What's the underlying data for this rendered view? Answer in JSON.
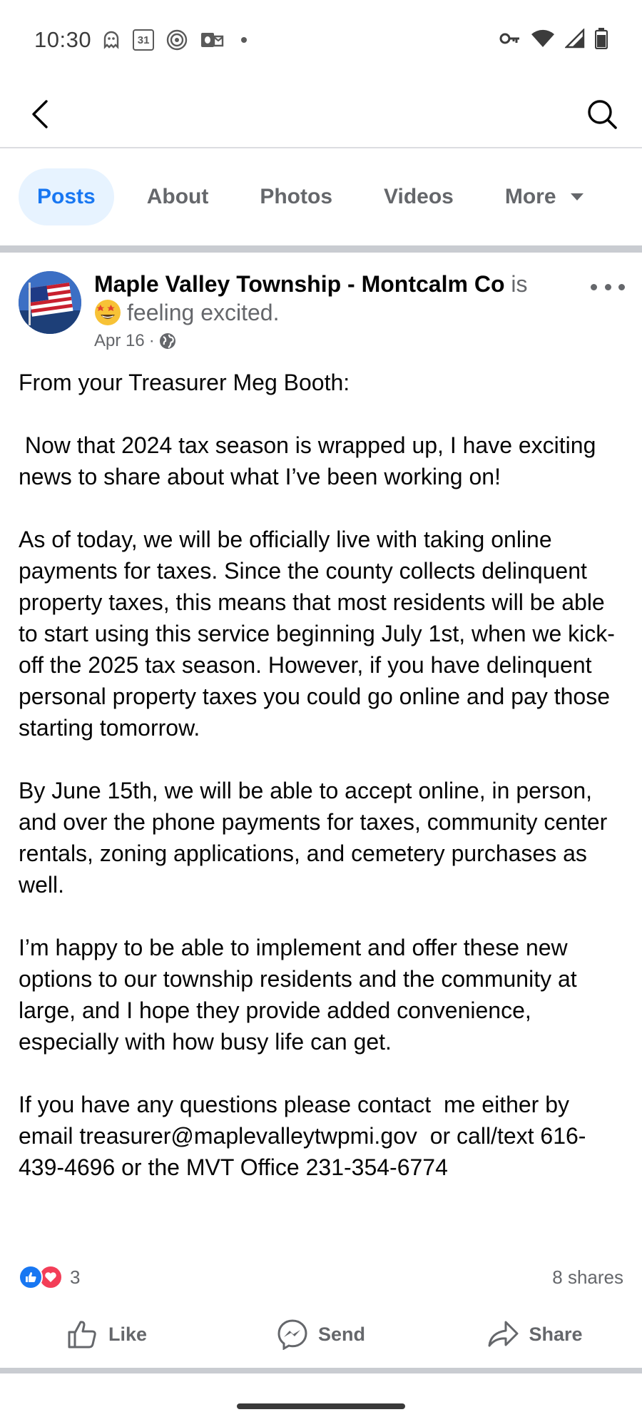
{
  "status_bar": {
    "time": "10:30",
    "left_icons": [
      "ghost-icon",
      "calendar-icon",
      "target-icon",
      "outlook-icon",
      "dot-icon"
    ],
    "calendar_day": "31",
    "right_icons": [
      "vpn-key-icon",
      "wifi-icon",
      "signal-icon",
      "battery-icon"
    ]
  },
  "header": {
    "back_icon": "back-arrow-icon",
    "search_icon": "search-icon"
  },
  "tabs": [
    {
      "label": "Posts",
      "active": true
    },
    {
      "label": "About",
      "active": false
    },
    {
      "label": "Photos",
      "active": false
    },
    {
      "label": "Videos",
      "active": false
    },
    {
      "label": "More",
      "active": false
    }
  ],
  "post": {
    "page_name": "Maple Valley Township - Montcalm Co",
    "is_text": " is",
    "feeling": "feeling excited.",
    "date": "Apr 16",
    "separator": "·",
    "audience_icon": "globe-icon",
    "paragraphs": [
      "From your Treasurer Meg Booth:",
      " Now that 2024 tax season is wrapped up, I have exciting news to share about what I’ve been working on!",
      "As of today, we will be officially live with taking online payments for taxes. Since the county collects delinquent property taxes, this means that most residents will be able to start using this service beginning July 1st, when we kick-off the 2025 tax season. However, if you have delinquent personal property taxes you could go online and pay those starting tomorrow.",
      "By June 15th, we will be able to accept online, in person, and over the phone payments for taxes, community center rentals, zoning applications, and cemetery purchases as well.",
      "I’m happy to be able to implement and offer these new options to our township residents and the community at large, and I hope they provide added convenience, especially with how busy life can get.",
      "If you have any questions please contact  me either by email treasurer@maplevalleytwpmi.gov  or call/text 616-439-4696 or the MVT Office 231-354-6774"
    ],
    "reaction_count": "3",
    "shares": "8 shares"
  },
  "actions": {
    "like": "Like",
    "send": "Send",
    "share": "Share"
  },
  "colors": {
    "accent": "#1877f2",
    "tab_active_bg": "#e7f3ff",
    "muted_text": "#65676b",
    "love": "#f33e58"
  }
}
